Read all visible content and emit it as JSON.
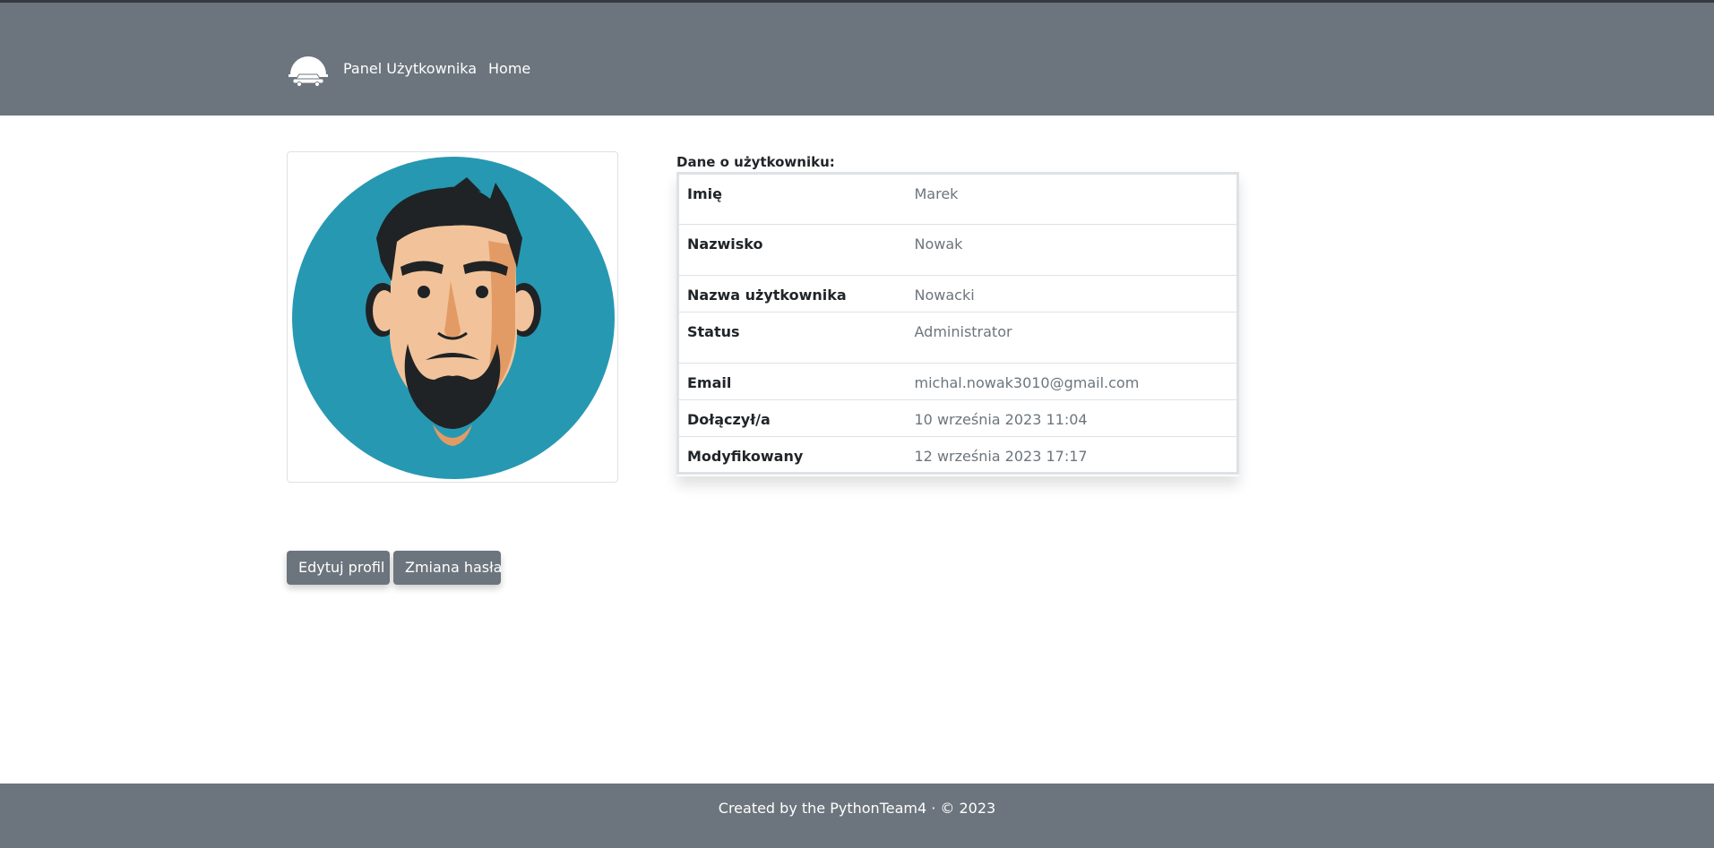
{
  "navbar": {
    "brand_label": "Panel Użytkownika",
    "home_label": "Home",
    "logo_icon": "cloud-car-logo-icon"
  },
  "profile": {
    "avatar_icon": "bearded-man-avatar",
    "avatar_bg": "#2798b2",
    "heading": "Dane o użytkowniku:",
    "rows": [
      {
        "label": "Imię",
        "value": "Marek"
      },
      {
        "label": "Nazwisko",
        "value": "Nowak"
      },
      {
        "label": "Nazwa użytkownika",
        "value": "Nowacki"
      },
      {
        "label": "Status",
        "value": "Administrator"
      },
      {
        "label": "Email",
        "value": "michal.nowak3010@gmail.com"
      },
      {
        "label": "Dołączył/a",
        "value": "10 września 2023 11:04"
      },
      {
        "label": "Modyfikowany",
        "value": "12 września 2023 17:17"
      }
    ]
  },
  "actions": {
    "edit_label": "Edytuj profil",
    "password_label": "Zmiana hasła"
  },
  "footer": {
    "text": "Created by the PythonTeam4 · © 2023"
  },
  "colors": {
    "nav_bg": "#6c757d",
    "button_bg": "#6c757d",
    "muted_text": "#6c757d"
  }
}
